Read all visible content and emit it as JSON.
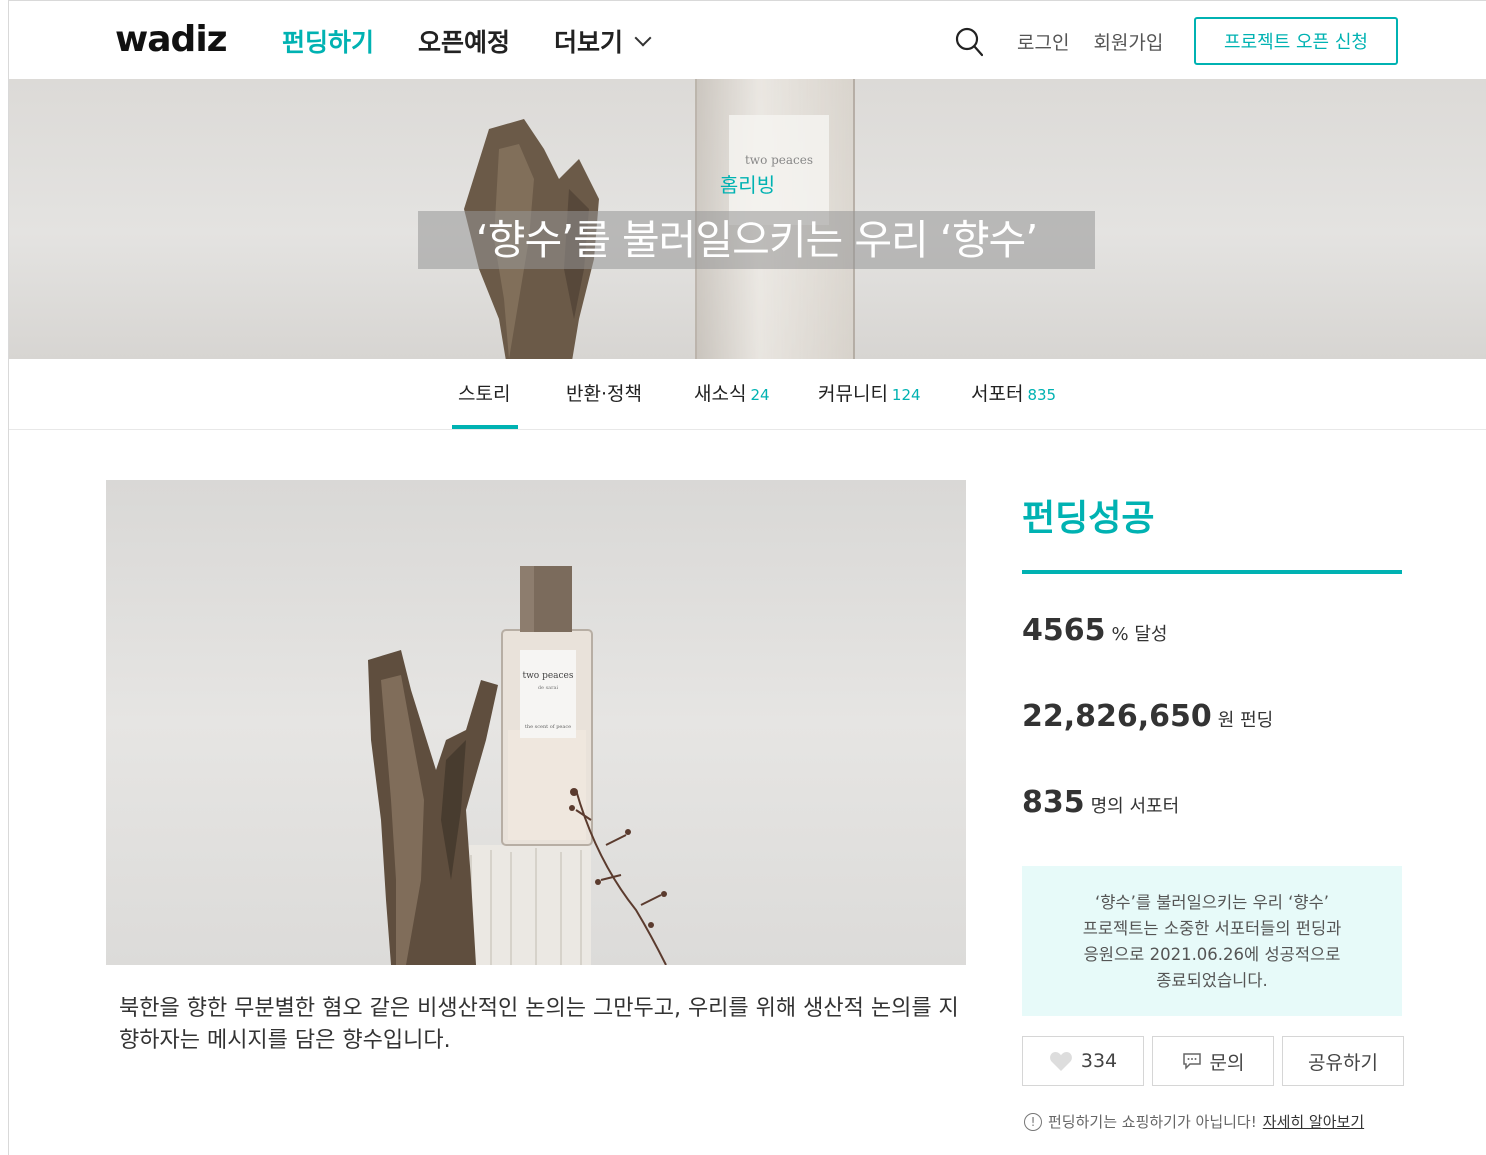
{
  "header": {
    "logo": "wadiz",
    "nav": [
      {
        "label": "펀딩하기"
      },
      {
        "label": "오픈예정"
      },
      {
        "label": "더보기"
      }
    ],
    "login": "로그인",
    "signup": "회원가입",
    "open_project": "프로젝트 오픈 신청"
  },
  "hero": {
    "category": "홈리빙",
    "title": "‘향수’를 불러일으키는 우리 ‘향수’",
    "bottle_label": "two peaces"
  },
  "tabs": [
    {
      "label": "스토리",
      "count": ""
    },
    {
      "label": "반환·정책",
      "count": ""
    },
    {
      "label": "새소식",
      "count": "24"
    },
    {
      "label": "커뮤니티",
      "count": "124"
    },
    {
      "label": "서포터",
      "count": "835"
    }
  ],
  "product_image": {
    "label_top": "two peaces",
    "label_sub": "de sarai",
    "label_bottom": "the scent of peace"
  },
  "description": "북한을 향한 무분별한 혐오 같은 비생산적인 논의는 그만두고, 우리를 위해 생산적 논의를 지향하자는 메시지를 담은 향수입니다.",
  "sidebar": {
    "status": "펀딩성공",
    "achievement": {
      "value": "4565",
      "unit": "% 달성"
    },
    "amount": {
      "value": "22,826,650",
      "unit": "원 펀딩"
    },
    "supporters": {
      "value": "835",
      "unit": "명의 서포터"
    },
    "notice_lines": [
      "‘향수’를 불러일으키는 우리 ‘향수’",
      "프로젝트는 소중한 서포터들의 펀딩과",
      "응원으로 2021.06.26에 성공적으로",
      "종료되었습니다."
    ],
    "like_count": "334",
    "inquiry": "문의",
    "share": "공유하기",
    "footnote": "펀딩하기는 쇼핑하기가 아닙니다!",
    "footnote_link": "자세히 알아보기"
  },
  "colors": {
    "accent": "#00b2b2",
    "notice_bg": "#e7faf9"
  }
}
